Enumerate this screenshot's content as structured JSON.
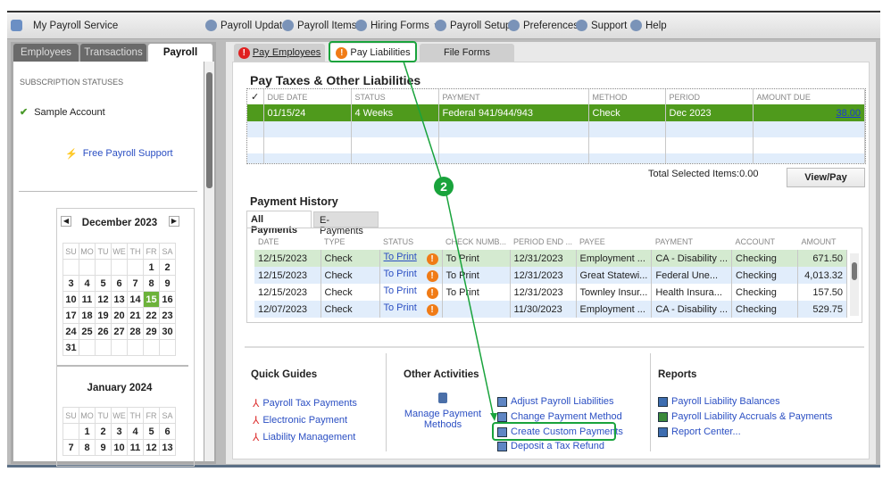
{
  "toolbar": {
    "app_title": "My Payroll Service",
    "items": [
      {
        "label": "Payroll Updates",
        "icon": "refresh-icon"
      },
      {
        "label": "Payroll Items",
        "icon": "list-icon"
      },
      {
        "label": "Hiring Forms",
        "icon": "document-icon"
      },
      {
        "label": "Payroll Setup",
        "icon": "tools-icon"
      },
      {
        "label": "Preferences",
        "icon": "gear-icon"
      },
      {
        "label": "Support",
        "icon": "lifebuoy-icon"
      },
      {
        "label": "Help",
        "icon": "question-icon"
      }
    ]
  },
  "left": {
    "tabs": [
      "Employees",
      "Transactions",
      "Payroll"
    ],
    "active_tab": "Payroll",
    "subscription_heading": "SUBSCRIPTION STATUSES",
    "account": "Sample Account",
    "support_link": "Free Payroll Support",
    "dow": [
      "SU",
      "MO",
      "TU",
      "WE",
      "TH",
      "FR",
      "SA"
    ],
    "calendars": [
      {
        "title": "December 2023",
        "weeks": [
          [
            "",
            "",
            "",
            "",
            "",
            "1",
            "2"
          ],
          [
            "3",
            "4",
            "5",
            "6",
            "7",
            "8",
            "9"
          ],
          [
            "10",
            "11",
            "12",
            "13",
            "14",
            "15",
            "16"
          ],
          [
            "17",
            "18",
            "19",
            "20",
            "21",
            "22",
            "23"
          ],
          [
            "24",
            "25",
            "26",
            "27",
            "28",
            "29",
            "30"
          ],
          [
            "31",
            "",
            "",
            "",
            "",
            "",
            ""
          ]
        ],
        "selected": "15"
      },
      {
        "title": "January 2024",
        "weeks": [
          [
            "",
            "1",
            "2",
            "3",
            "4",
            "5",
            "6"
          ],
          [
            "7",
            "8",
            "9",
            "10",
            "11",
            "12",
            "13"
          ]
        ]
      }
    ]
  },
  "tabs": [
    {
      "label": "Pay Employees",
      "icon": "error-icon",
      "color": "#e02020"
    },
    {
      "label": "Pay Liabilities",
      "icon": "warning-icon",
      "color": "#f07b16"
    },
    {
      "label": "File Forms"
    }
  ],
  "liabilities": {
    "title": "Pay Taxes & Other Liabilities",
    "columns": [
      "✓",
      "DUE DATE",
      "STATUS",
      "PAYMENT",
      "METHOD",
      "PERIOD",
      "AMOUNT DUE"
    ],
    "rows": [
      [
        "",
        "01/15/24",
        "4 Weeks",
        "Federal 941/944/943",
        "Check",
        "Dec 2023",
        "38.00"
      ]
    ],
    "total_label": "Total Selected Items:",
    "total_value": "0.00",
    "view_pay": "View/Pay"
  },
  "history": {
    "title": "Payment History",
    "tabs": [
      "All Payments",
      "E-Payments"
    ],
    "columns": [
      "DATE",
      "TYPE",
      "STATUS",
      "CHECK NUMB...",
      "PERIOD END ...",
      "PAYEE",
      "PAYMENT",
      "ACCOUNT",
      "AMOUNT"
    ],
    "rows": [
      [
        "12/15/2023",
        "Check",
        "To Print",
        "To Print",
        "12/31/2023",
        "Employment ...",
        "CA - Disability ...",
        "Checking",
        "671.50"
      ],
      [
        "12/15/2023",
        "Check",
        "To Print",
        "To Print",
        "12/31/2023",
        "Great Statewi...",
        "Federal Une...",
        "Checking",
        "4,013.32"
      ],
      [
        "12/15/2023",
        "Check",
        "To Print",
        "To Print",
        "12/31/2023",
        "Townley Insur...",
        "Health Insura...",
        "Checking",
        "157.50"
      ],
      [
        "12/07/2023",
        "Check",
        "To Print",
        "",
        "11/30/2023",
        "Employment ...",
        "CA - Disability ...",
        "Checking",
        "529.75"
      ]
    ]
  },
  "quick_guides": {
    "title": "Quick Guides",
    "items": [
      "Payroll Tax Payments",
      "Electronic Payment",
      "Liability Management"
    ]
  },
  "other": {
    "title": "Other Activities",
    "manage": "Manage Payment Methods",
    "items": [
      "Adjust Payroll Liabilities",
      "Change Payment Method",
      "Create Custom Payments",
      "Deposit a Tax Refund"
    ]
  },
  "reports": {
    "title": "Reports",
    "items": [
      "Payroll Liability Balances",
      "Payroll Liability Accruals & Payments",
      "Report Center..."
    ]
  },
  "annotation": {
    "step": "2",
    "color": "#19a33c"
  },
  "colors": {
    "selected_row": "#4f9a1c",
    "history_selected": "#d4ead0",
    "alt_row": "#e1edfb"
  }
}
